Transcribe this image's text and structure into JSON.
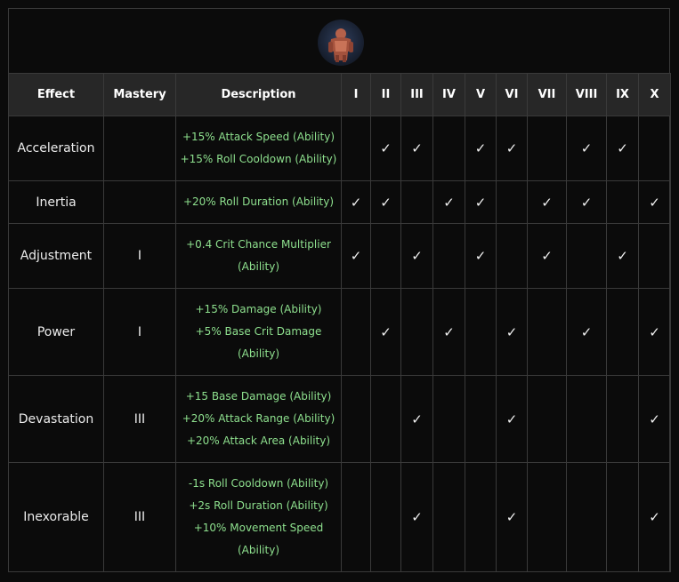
{
  "headers": {
    "effect": "Effect",
    "mastery": "Mastery",
    "description": "Description",
    "levels": [
      "I",
      "II",
      "III",
      "IV",
      "V",
      "VI",
      "VII",
      "VIII",
      "IX",
      "X"
    ]
  },
  "check_symbol": "✓",
  "rows": [
    {
      "effect": "Acceleration",
      "mastery": "",
      "description": [
        "+15% Attack Speed (Ability)",
        "+15% Roll Cooldown (Ability)"
      ],
      "checks": [
        false,
        true,
        true,
        false,
        true,
        true,
        false,
        true,
        true,
        false
      ]
    },
    {
      "effect": "Inertia",
      "mastery": "",
      "description": [
        "+20% Roll Duration (Ability)"
      ],
      "checks": [
        true,
        true,
        false,
        true,
        true,
        false,
        true,
        true,
        false,
        true
      ]
    },
    {
      "effect": "Adjustment",
      "mastery": "I",
      "description": [
        "+0.4 Crit Chance Multiplier",
        "(Ability)"
      ],
      "checks": [
        true,
        false,
        true,
        false,
        true,
        false,
        true,
        false,
        true,
        false
      ]
    },
    {
      "effect": "Power",
      "mastery": "I",
      "description": [
        "+15% Damage (Ability)",
        "+5% Base Crit Damage",
        "(Ability)"
      ],
      "checks": [
        false,
        true,
        false,
        true,
        false,
        true,
        false,
        true,
        false,
        true
      ]
    },
    {
      "effect": "Devastation",
      "mastery": "III",
      "description": [
        "+15 Base Damage (Ability)",
        "+20% Attack Range (Ability)",
        "+20% Attack Area (Ability)"
      ],
      "checks": [
        false,
        false,
        true,
        false,
        false,
        true,
        false,
        false,
        false,
        true
      ]
    },
    {
      "effect": "Inexorable",
      "mastery": "III",
      "description": [
        "-1s Roll Cooldown (Ability)",
        "+2s Roll Duration (Ability)",
        "+10% Movement Speed",
        "(Ability)"
      ],
      "checks": [
        false,
        false,
        true,
        false,
        false,
        true,
        false,
        false,
        false,
        true
      ]
    }
  ]
}
